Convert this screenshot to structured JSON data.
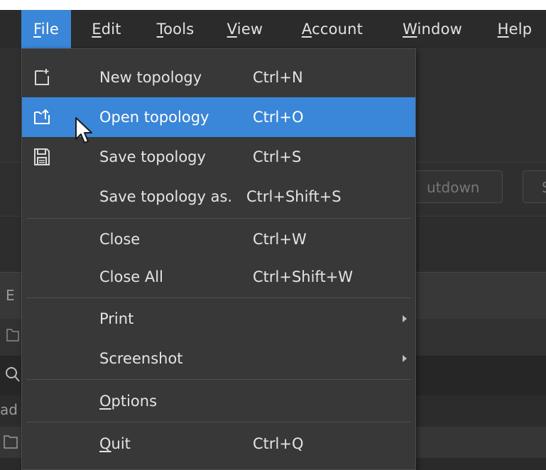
{
  "menubar": {
    "items": [
      {
        "mnemonic": "F",
        "rest": "ile",
        "active": true
      },
      {
        "mnemonic": "E",
        "rest": "dit",
        "active": false
      },
      {
        "mnemonic": "T",
        "rest": "ools",
        "active": false
      },
      {
        "mnemonic": "V",
        "rest": "iew",
        "active": false
      },
      {
        "mnemonic": "A",
        "rest": "ccount",
        "active": false
      },
      {
        "mnemonic": "W",
        "rest": "indow",
        "active": false
      },
      {
        "mnemonic": "H",
        "rest": "elp",
        "active": false
      }
    ]
  },
  "file_menu": {
    "items": [
      {
        "label": "New topology",
        "shortcut": "Ctrl+N",
        "icon": "new-file-icon"
      },
      {
        "label": "Open topology",
        "shortcut": "Ctrl+O",
        "icon": "open-folder-icon",
        "highlighted": true
      },
      {
        "label": "Save topology",
        "shortcut": "Ctrl+S",
        "icon": "save-icon"
      },
      {
        "label": "Save topology as.",
        "shortcut": "Ctrl+Shift+S"
      },
      {
        "label": "Close",
        "shortcut": "Ctrl+W"
      },
      {
        "label": "Close All",
        "shortcut": "Ctrl+Shift+W"
      },
      {
        "label": "Print",
        "submenu": true
      },
      {
        "label": "Screenshot",
        "submenu": true
      },
      {
        "mnemonic": "O",
        "rest": "ptions"
      },
      {
        "mnemonic": "Q",
        "rest": "uit",
        "shortcut": "Ctrl+Q"
      }
    ]
  },
  "background": {
    "shutdown_fragment": "utdown",
    "next_fragment": "S",
    "panel_fragment": "E",
    "row_fragment": "ad"
  },
  "colors": {
    "accent": "#3a86d8",
    "menu_bg": "#383838",
    "menubar_bg": "#2b2b2b",
    "text": "#e4e4e4"
  }
}
